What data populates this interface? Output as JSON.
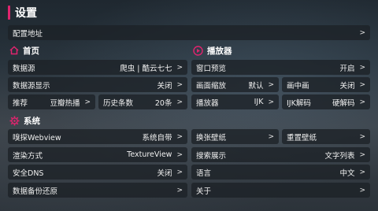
{
  "header": {
    "title": "设置"
  },
  "config_address": {
    "label": "配置地址",
    "arrow": ">"
  },
  "sections": {
    "home": {
      "title": "首页",
      "icon": "home-icon"
    },
    "player": {
      "title": "播放器",
      "icon": "play-circle-icon"
    },
    "system": {
      "title": "系统",
      "icon": "gear-icon"
    }
  },
  "home": {
    "data_source": {
      "label": "数据源",
      "value": "爬虫 | 酷云七七",
      "arrow": ">"
    },
    "data_source_display": {
      "label": "数据源显示",
      "value": "关闭",
      "arrow": ">"
    },
    "recommend": {
      "label": "推荐",
      "value": "豆瓣热播",
      "arrow": ">"
    },
    "history_count": {
      "label": "历史条数",
      "value": "20条",
      "arrow": ">"
    }
  },
  "player": {
    "window_preview": {
      "label": "窗口预览",
      "value": "开启",
      "arrow": ">"
    },
    "picture_scale": {
      "label": "画面缩放",
      "value": "默认",
      "arrow": ">"
    },
    "pip": {
      "label": "画中画",
      "value": "关闭",
      "arrow": ">"
    },
    "player": {
      "label": "播放器",
      "value": "IJK",
      "arrow": ">"
    },
    "ijk_decode": {
      "label": "IJK解码",
      "value": "硬解码",
      "arrow": ">"
    }
  },
  "system": {
    "sniff_webview": {
      "label": "嗅探Webview",
      "value": "系统自带",
      "arrow": ">"
    },
    "render_mode": {
      "label": "渲染方式",
      "value": "TextureView",
      "arrow": ">"
    },
    "secure_dns": {
      "label": "安全DNS",
      "value": "关闭",
      "arrow": ">"
    },
    "backup_restore": {
      "label": "数据备份还原",
      "arrow": ">"
    },
    "change_wallpaper": {
      "label": "换张壁纸",
      "arrow": ">"
    },
    "reset_wallpaper": {
      "label": "重置壁纸",
      "arrow": ">"
    },
    "search_display": {
      "label": "搜索展示",
      "value": "文字列表",
      "arrow": ">"
    },
    "language": {
      "label": "语言",
      "value": "中文",
      "arrow": ">"
    },
    "about": {
      "label": "关于",
      "arrow": ">"
    }
  },
  "colors": {
    "accent": "#e0246e",
    "row_bg": "rgba(28,33,38,0.78)"
  }
}
